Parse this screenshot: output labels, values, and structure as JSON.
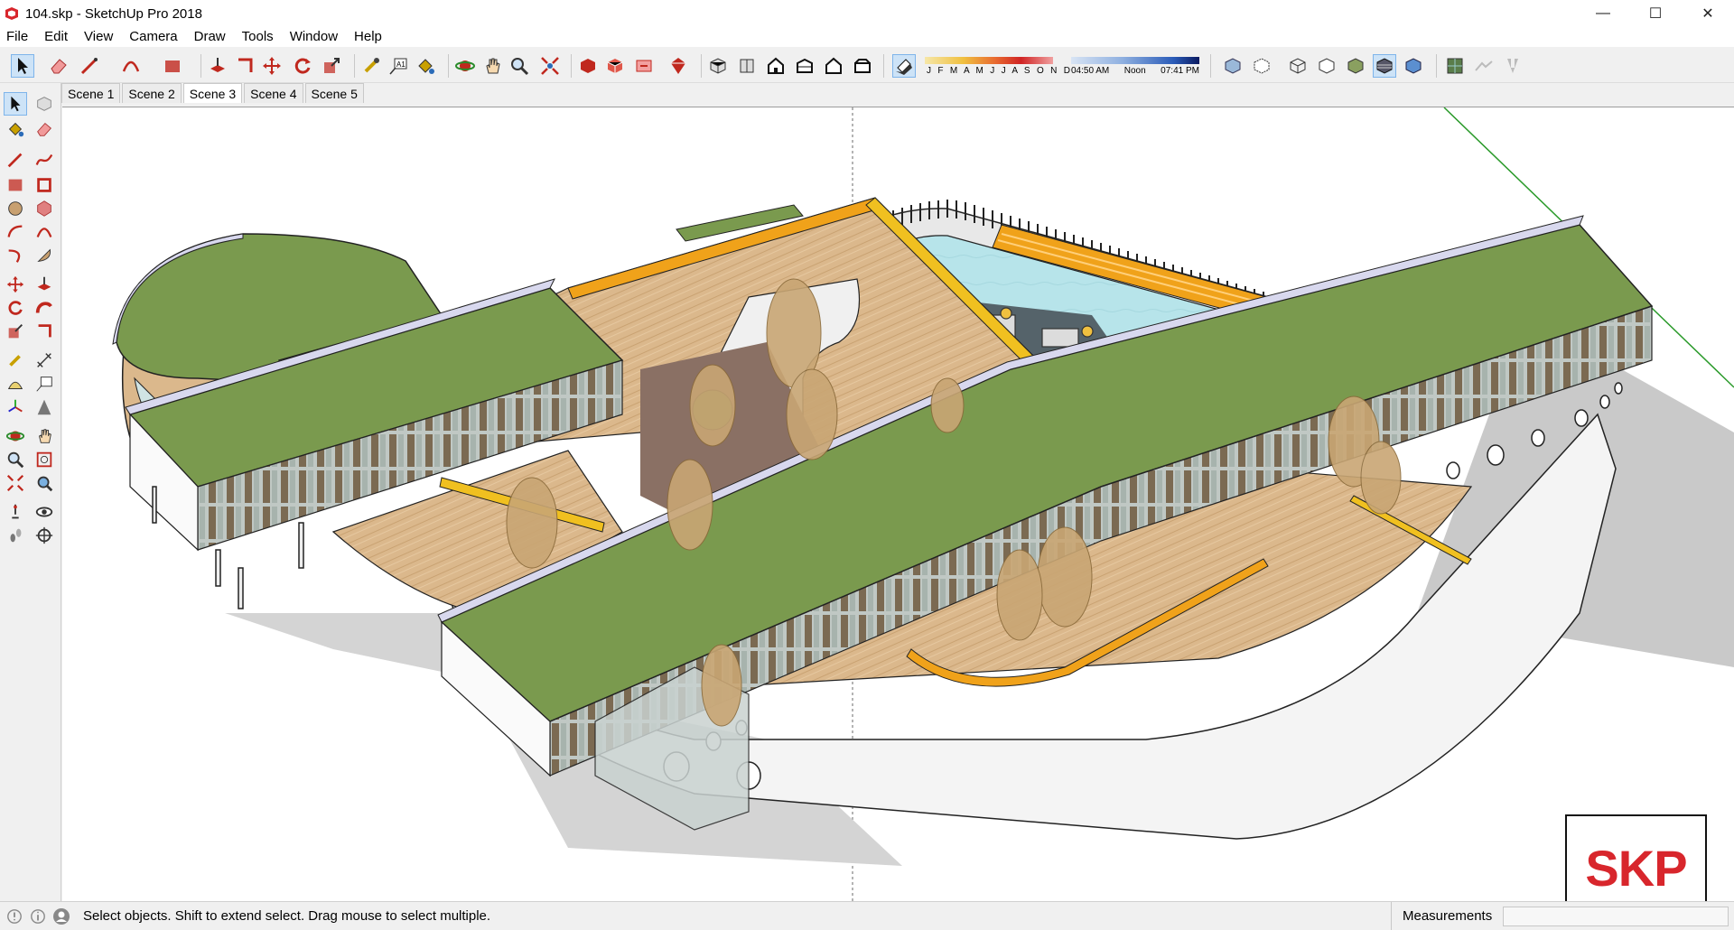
{
  "window": {
    "title": "104.skp - SketchUp Pro 2018",
    "controls": {
      "minimize": "—",
      "maximize": "☐",
      "close": "✕"
    }
  },
  "menu": {
    "items": [
      "File",
      "Edit",
      "View",
      "Camera",
      "Draw",
      "Tools",
      "Window",
      "Help"
    ]
  },
  "toolbar": {
    "shadow_months": "J F M A M J J A S O N D",
    "shadow_time": {
      "start": "04:50 AM",
      "noon": "Noon",
      "end": "07:41 PM"
    }
  },
  "scenes": {
    "tabs": [
      "Scene 1",
      "Scene 2",
      "Scene 3",
      "Scene 4",
      "Scene 5"
    ],
    "active_index": 2
  },
  "statusbar": {
    "hint": "Select objects. Shift to extend select. Drag mouse to select multiple.",
    "measurements_label": "Measurements",
    "measurements_value": ""
  },
  "logo": {
    "text": "SKP",
    "color": "#d8262c"
  },
  "colors": {
    "roof_green": "#7a9a4e",
    "deck_wood": "#d9b68a",
    "trim_orange": "#f0a21a",
    "pool_blue": "#b7e4ea",
    "wall_white": "#f4f4f4",
    "glass_grey": "#b9c6c9"
  }
}
